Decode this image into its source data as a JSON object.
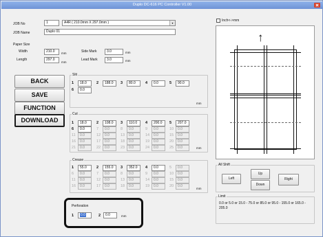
{
  "window": {
    "title": "Duplo DC-616 PC Controller V1.00"
  },
  "job": {
    "no_label": "JOB No",
    "no_value": "1",
    "name_label": "JOB Name",
    "name_value": "Duplo 01",
    "paper_value": "A4R ( 210.0mm X 297.0mm )"
  },
  "paper_size": {
    "label": "Paper Size",
    "width_label": "Width",
    "width_value": "210.0",
    "length_label": "Length",
    "length_value": "297.0",
    "unit": "mm",
    "side_mark_label": "Side Mark",
    "side_mark_value": "3.0",
    "lead_mark_label": "Lead Mark",
    "lead_mark_value": "3.0"
  },
  "buttons": {
    "back": "BACK",
    "save": "SAVE",
    "function": "FUNCTION",
    "download": "DOWNLOAD"
  },
  "slit": {
    "label": "Slit",
    "unit": "mm",
    "fields": [
      {
        "n": "1",
        "v": "18.0",
        "dis": false
      },
      {
        "n": "2",
        "v": "188.0",
        "dis": false
      },
      {
        "n": "3",
        "v": "80.0",
        "dis": false
      },
      {
        "n": "4",
        "v": "0.0",
        "dis": false
      },
      {
        "n": "5",
        "v": "90.0",
        "dis": false
      },
      {
        "n": "6",
        "v": "0.0",
        "dis": false
      }
    ]
  },
  "cut": {
    "label": "Cut",
    "unit": "mm",
    "fields": [
      {
        "n": "1",
        "v": "18.0",
        "dis": false
      },
      {
        "n": "2",
        "v": "108.0",
        "dis": false
      },
      {
        "n": "3",
        "v": "110.0",
        "dis": false
      },
      {
        "n": "4",
        "v": "200.0",
        "dis": false
      },
      {
        "n": "5",
        "v": "207.0",
        "dis": false
      },
      {
        "n": "6",
        "v": "0.0",
        "dis": false
      },
      {
        "n": "7",
        "v": "0.0",
        "dis": true
      },
      {
        "n": "8",
        "v": "0.0",
        "dis": true
      },
      {
        "n": "9",
        "v": "0.0",
        "dis": true
      },
      {
        "n": "10",
        "v": "0.0",
        "dis": true
      },
      {
        "n": "11",
        "v": "0.0",
        "dis": true
      },
      {
        "n": "12",
        "v": "0.0",
        "dis": true
      },
      {
        "n": "13",
        "v": "0.0",
        "dis": true
      },
      {
        "n": "14",
        "v": "0.0",
        "dis": true
      },
      {
        "n": "15",
        "v": "0.0",
        "dis": true
      },
      {
        "n": "16",
        "v": "0.0",
        "dis": true
      },
      {
        "n": "17",
        "v": "0.0",
        "dis": true
      },
      {
        "n": "18",
        "v": "0.0",
        "dis": true
      },
      {
        "n": "19",
        "v": "0.0",
        "dis": true
      },
      {
        "n": "20",
        "v": "0.0",
        "dis": true
      },
      {
        "n": "21",
        "v": "0.0",
        "dis": true
      },
      {
        "n": "22",
        "v": "0.0",
        "dis": true
      },
      {
        "n": "23",
        "v": "0.0",
        "dis": true
      },
      {
        "n": "24",
        "v": "0.0",
        "dis": true
      },
      {
        "n": "25",
        "v": "0.0",
        "dis": true
      }
    ]
  },
  "crease": {
    "label": "Crease",
    "unit": "mm",
    "fields": [
      {
        "n": "1",
        "v": "55.0",
        "dis": false
      },
      {
        "n": "2",
        "v": "155.0",
        "dis": false
      },
      {
        "n": "3",
        "v": "352.0",
        "dis": false
      },
      {
        "n": "4",
        "v": "0.0",
        "dis": false
      },
      {
        "n": "5",
        "v": "0.0",
        "dis": true
      },
      {
        "n": "6",
        "v": "0.0",
        "dis": true
      },
      {
        "n": "7",
        "v": "0.0",
        "dis": true
      },
      {
        "n": "8",
        "v": "0.0",
        "dis": true
      },
      {
        "n": "9",
        "v": "0.0",
        "dis": true
      },
      {
        "n": "10",
        "v": "0.0",
        "dis": true
      },
      {
        "n": "11",
        "v": "0.0",
        "dis": true
      },
      {
        "n": "12",
        "v": "0.0",
        "dis": true
      },
      {
        "n": "13",
        "v": "0.0",
        "dis": true
      },
      {
        "n": "14",
        "v": "0.0",
        "dis": true
      },
      {
        "n": "15",
        "v": "0.0",
        "dis": true
      },
      {
        "n": "16",
        "v": "0.0",
        "dis": true
      },
      {
        "n": "17",
        "v": "0.0",
        "dis": true
      },
      {
        "n": "18",
        "v": "0.0",
        "dis": true
      },
      {
        "n": "19",
        "v": "0.0",
        "dis": true
      },
      {
        "n": "20",
        "v": "0.0",
        "dis": true
      }
    ]
  },
  "perforation": {
    "label": "Perforation",
    "unit": "mm",
    "n1": "1",
    "v1": "0.0",
    "n2": "2",
    "v2": "0.0"
  },
  "preview": {
    "checkbox_label": "Inch<->mm",
    "arrow": "↑"
  },
  "all_shift": {
    "label": "All Shift",
    "up": "Up",
    "left": "Left",
    "right": "Right",
    "down": "Down"
  },
  "limit": {
    "label": "Limit",
    "text": "0.0 or 5.0 or 15.0 - 75.0 or 85.0 or 95.0 - 155.0 or 165.0 - 205.0"
  }
}
